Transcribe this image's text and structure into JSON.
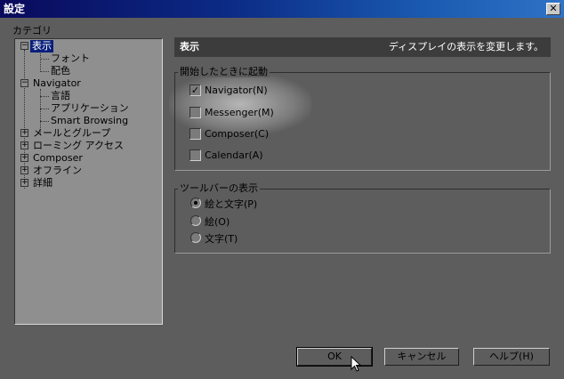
{
  "window": {
    "title": "設定",
    "close_glyph": "✕"
  },
  "category_label": "カテゴリ",
  "tree": {
    "items": [
      {
        "label": "表示",
        "expander": "−",
        "selected": true
      },
      {
        "label": "フォント"
      },
      {
        "label": "配色"
      },
      {
        "label": "Navigator",
        "expander": "−"
      },
      {
        "label": "言語"
      },
      {
        "label": "アプリケーション"
      },
      {
        "label": "Smart Browsing"
      },
      {
        "label": "メールとグループ",
        "expander": "+"
      },
      {
        "label": "ローミング アクセス",
        "expander": "+"
      },
      {
        "label": "Composer",
        "expander": "+"
      },
      {
        "label": "オフライン",
        "expander": "+"
      },
      {
        "label": "詳細",
        "expander": "+"
      }
    ]
  },
  "header": {
    "title": "表示",
    "description": "ディスプレイの表示を変更します。"
  },
  "startup_group": {
    "legend": "開始したときに起動",
    "options": [
      {
        "label": "Navigator(N)",
        "checked": true
      },
      {
        "label": "Messenger(M)",
        "checked": false
      },
      {
        "label": "Composer(C)",
        "checked": false
      },
      {
        "label": "Calendar(A)",
        "checked": false
      }
    ],
    "check_glyph": "✓"
  },
  "toolbar_group": {
    "legend": "ツールバーの表示",
    "options": [
      {
        "label": "絵と文字(P)",
        "selected": true
      },
      {
        "label": "絵(O)",
        "selected": false
      },
      {
        "label": "文字(T)",
        "selected": false
      }
    ]
  },
  "buttons": {
    "ok": "OK",
    "cancel": "キャンセル",
    "help": "ヘルプ(H)"
  }
}
